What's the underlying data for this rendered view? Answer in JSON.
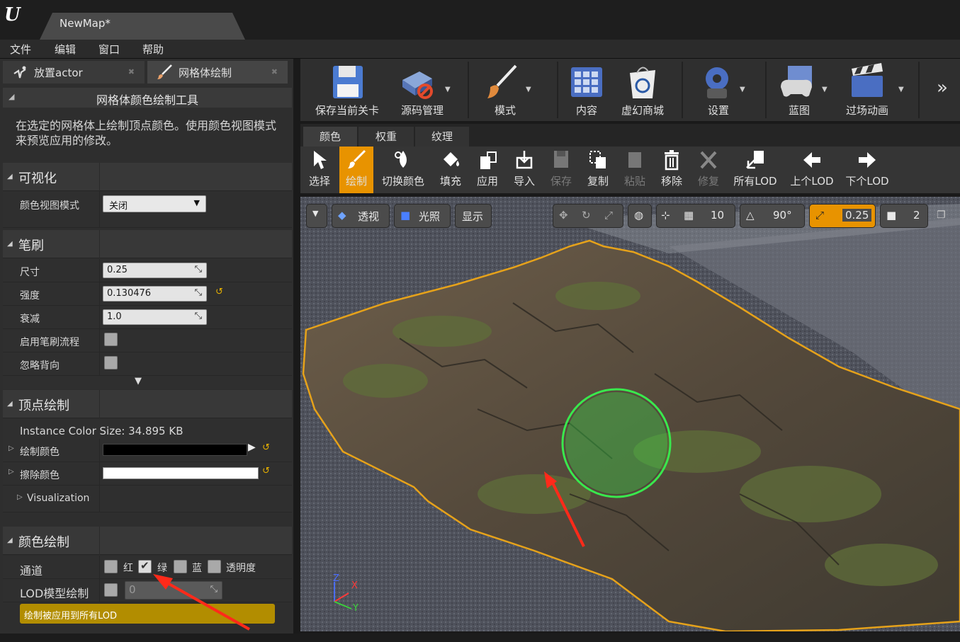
{
  "app": {
    "logo": "U",
    "doc_tab": "NewMap*"
  },
  "menu": [
    "文件",
    "编辑",
    "窗口",
    "帮助"
  ],
  "panel_tabs": [
    {
      "label": "放置actor",
      "icon": "place-actor-icon"
    },
    {
      "label": "网格体绘制",
      "icon": "paint-brush-icon"
    }
  ],
  "tool_header": "网格体颜色绘制工具",
  "tool_desc": "在选定的网格体上绘制顶点颜色。使用颜色视图模式来预览应用的修改。",
  "visualization": {
    "title": "可视化",
    "color_view_mode_label": "颜色视图模式",
    "color_view_mode_value": "关闭"
  },
  "brush": {
    "title": "笔刷",
    "size_label": "尺寸",
    "size_value": "0.25",
    "strength_label": "强度",
    "strength_value": "0.130476",
    "falloff_label": "衰减",
    "falloff_value": "1.0",
    "flow_label": "启用笔刷流程",
    "ignore_back_label": "忽略背向"
  },
  "vertex_paint": {
    "title": "顶点绘制",
    "instance_size": "Instance Color Size: 34.895 KB",
    "paint_color_label": "绘制颜色",
    "erase_color_label": "擦除颜色",
    "visualization_label": "Visualization"
  },
  "color_paint": {
    "title": "颜色绘制",
    "channel_label": "通道",
    "channels": [
      {
        "label": "红",
        "checked": false
      },
      {
        "label": "绿",
        "checked": true
      },
      {
        "label": "蓝",
        "checked": false
      },
      {
        "label": "透明度",
        "checked": false
      }
    ],
    "lod_label": "LOD模型绘制",
    "lod_value": "0",
    "apply_all_lod": "绘制被应用到所有LOD"
  },
  "main_toolbar": [
    {
      "label": "保存当前关卡",
      "icon": "save-icon"
    },
    {
      "label": "源码管理",
      "icon": "source-control-icon"
    },
    {
      "label": "模式",
      "icon": "modes-icon"
    },
    {
      "label": "内容",
      "icon": "content-browser-icon"
    },
    {
      "label": "虚幻商城",
      "icon": "marketplace-icon"
    },
    {
      "label": "设置",
      "icon": "settings-icon"
    },
    {
      "label": "蓝图",
      "icon": "blueprint-icon"
    },
    {
      "label": "过场动画",
      "icon": "cinematics-icon"
    }
  ],
  "mode_tabs": [
    "颜色",
    "权重",
    "纹理"
  ],
  "paint_tools": [
    {
      "label": "选择",
      "state": "normal"
    },
    {
      "label": "绘制",
      "state": "active"
    },
    {
      "label": "切换颜色",
      "state": "normal"
    },
    {
      "label": "填充",
      "state": "normal"
    },
    {
      "label": "应用",
      "state": "normal"
    },
    {
      "label": "导入",
      "state": "normal"
    },
    {
      "label": "保存",
      "state": "disabled"
    },
    {
      "label": "复制",
      "state": "normal"
    },
    {
      "label": "粘贴",
      "state": "disabled"
    },
    {
      "label": "移除",
      "state": "normal"
    },
    {
      "label": "修复",
      "state": "disabled"
    },
    {
      "label": "所有LOD",
      "state": "normal"
    },
    {
      "label": "上个LOD",
      "state": "normal"
    },
    {
      "label": "下个LOD",
      "state": "normal"
    }
  ],
  "viewport": {
    "perspective": "透视",
    "lighting": "光照",
    "show": "显示",
    "grid_snap": "10",
    "angle_snap": "90°",
    "scale_snap": "0.25",
    "camera_speed": "2",
    "axis_labels": [
      "Z",
      "X",
      "Y"
    ]
  },
  "colors": {
    "accent": "#e89300",
    "selection_outline": "#e6a21a",
    "brush_circle": "#39e84d"
  }
}
